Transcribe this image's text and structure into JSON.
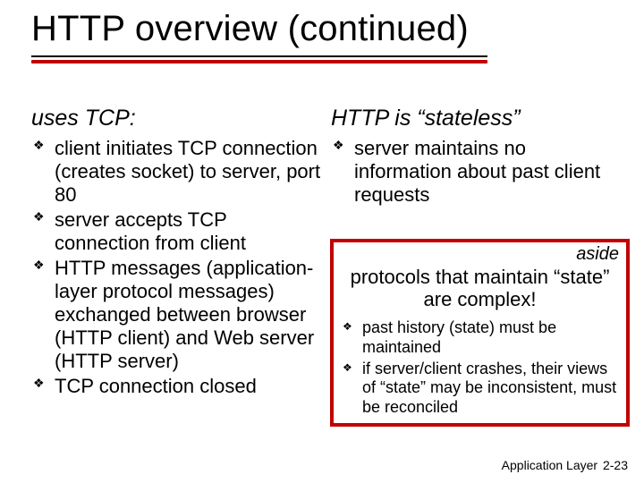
{
  "title": "HTTP overview (continued)",
  "left": {
    "heading": "uses TCP:",
    "items": [
      "client initiates TCP connection (creates socket) to server,  port 80",
      "server accepts TCP connection from client",
      "HTTP messages (application-layer protocol messages) exchanged between browser (HTTP client) and Web server (HTTP server)",
      "TCP connection closed"
    ]
  },
  "right": {
    "heading": "HTTP is “stateless”",
    "items": [
      "server maintains no information about past client requests"
    ]
  },
  "aside": {
    "label": "aside",
    "main": "protocols that maintain “state” are complex!",
    "items": [
      "past history (state) must be maintained",
      "if server/client crashes, their views of “state” may be inconsistent, must be reconciled"
    ]
  },
  "footer": {
    "section": "Application Layer",
    "page": "2-23"
  }
}
